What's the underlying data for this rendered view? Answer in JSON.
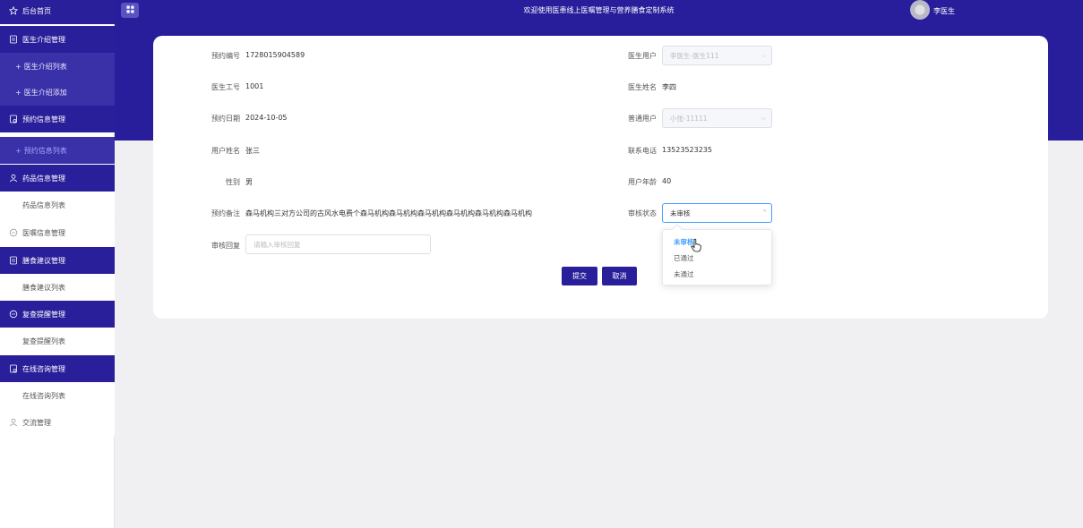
{
  "sidebar": {
    "items": [
      {
        "label": "后台首页",
        "icon": "star-icon"
      },
      {
        "label": "医生介绍管理",
        "icon": "document-icon"
      },
      {
        "label": "医生介绍列表",
        "icon": "plus-icon"
      },
      {
        "label": "医生介绍添加",
        "icon": "plus-icon"
      },
      {
        "label": "预约信息管理",
        "icon": "calendar-icon"
      },
      {
        "label": "预约信息列表",
        "icon": "plus-icon"
      },
      {
        "label": "药品信息管理",
        "icon": "user-icon"
      },
      {
        "label": "药品信息列表",
        "icon": ""
      },
      {
        "label": "医嘱信息管理",
        "icon": "chat-icon"
      },
      {
        "label": "膳食建议管理",
        "icon": "document-icon"
      },
      {
        "label": "膳食建议列表",
        "icon": ""
      },
      {
        "label": "复查提醒管理",
        "icon": "chat-icon"
      },
      {
        "label": "复查提醒列表",
        "icon": ""
      },
      {
        "label": "在线咨询管理",
        "icon": "calendar-icon"
      },
      {
        "label": "在线咨询列表",
        "icon": ""
      },
      {
        "label": "交流管理",
        "icon": "user-icon"
      }
    ]
  },
  "header": {
    "title": "欢迎使用医患线上医嘱管理与营养膳食定制系统",
    "user": "李医生"
  },
  "form": {
    "appt_no_label": "预约编号",
    "appt_no": "1728015904589",
    "doctor_user_label": "医生用户",
    "doctor_user": "李医生-医生111",
    "doctor_id_label": "医生工号",
    "doctor_id": "1001",
    "doctor_name_label": "医生姓名",
    "doctor_name": "李四",
    "appt_date_label": "预约日期",
    "appt_date": "2024-10-05",
    "normal_user_label": "普通用户",
    "normal_user": "小张-11111",
    "user_name_label": "用户姓名",
    "user_name": "张三",
    "phone_label": "联系电话",
    "phone": "13523523235",
    "gender_label": "性别",
    "gender": "男",
    "age_label": "用户年龄",
    "age": "40",
    "remark_label": "预约备注",
    "remark": "森马机构三对方公司的古风水电费个森马机构森马机构森马机构森马机构森马机构森马机构",
    "review_status_label": "审核状态",
    "review_status": "未审核",
    "review_reply_label": "审核回复",
    "review_reply_placeholder": "请输入审核回复",
    "submit": "提交",
    "cancel": "取消"
  },
  "dropdown": {
    "options": [
      "未审核",
      "已通过",
      "未通过"
    ],
    "selected": "未审核"
  },
  "colors": {
    "primary": "#281d9b",
    "accent": "#409eff"
  }
}
